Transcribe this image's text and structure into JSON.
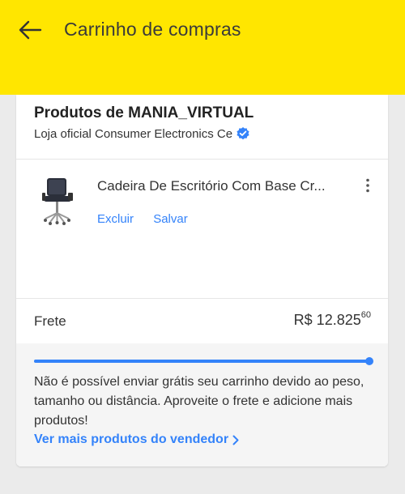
{
  "header": {
    "title": "Carrinho de compras",
    "back_icon": "arrow-left-icon",
    "color": "#ffe600"
  },
  "seller": {
    "title": "Produtos de MANIA_VIRTUAL",
    "subtitle": "Loja oficial Consumer Electronics Ce",
    "verified_icon": "verified-badge-icon"
  },
  "product": {
    "name": "Cadeira De Escritório Com Base Cr...",
    "image_icon": "office-chair-icon",
    "more_icon": "more-vertical-icon",
    "actions": {
      "remove": "Excluir",
      "save": "Salvar"
    }
  },
  "shipping": {
    "label": "Frete",
    "price_main": "R$ 12.825",
    "price_cents": "60",
    "progress": 1.0,
    "message": "Não é possível enviar grátis seu carrinho devido ao peso, tamanho ou distância. Aproveite o frete e adicione mais produtos!",
    "link": "Ver mais produtos do vendedor"
  },
  "colors": {
    "accent": "#3483fa",
    "header": "#ffe600",
    "background": "#ebebeb"
  }
}
